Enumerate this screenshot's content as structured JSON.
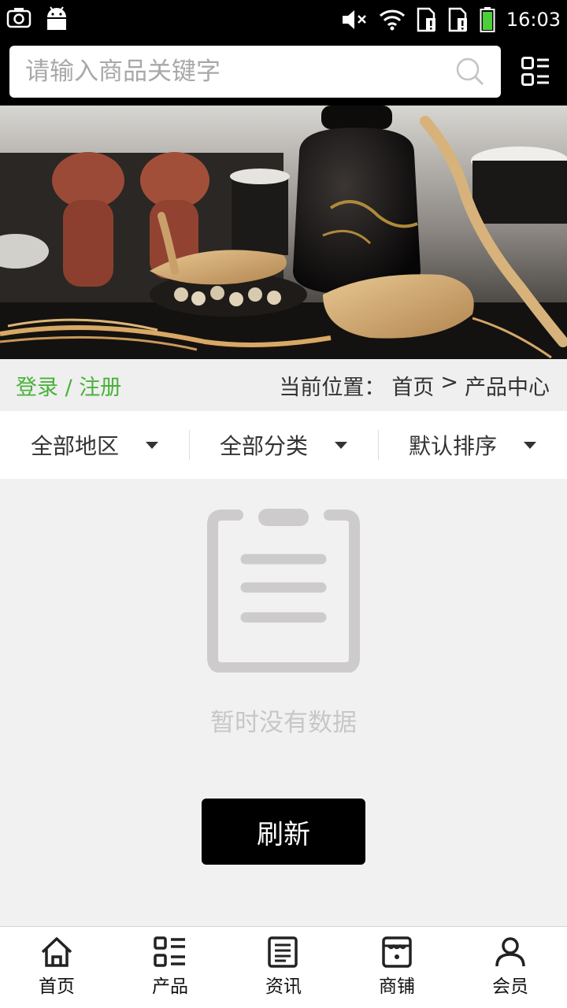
{
  "status_bar": {
    "time": "16:03",
    "left_icons": [
      "screenshot-icon",
      "android-icon"
    ],
    "right_icons": [
      "mute-icon",
      "wifi-icon",
      "sim1-icon",
      "sim2-icon",
      "battery-icon"
    ]
  },
  "search": {
    "placeholder": "请输入商品关键字"
  },
  "banner": {
    "alt": "ginseng"
  },
  "location_bar": {
    "login_label": "登录 / 注册",
    "prefix": "当前位置：",
    "crumb_home": "首页",
    "separator": ">",
    "crumb_current": "产品中心"
  },
  "filters": [
    {
      "label": "全部地区"
    },
    {
      "label": "全部分类"
    },
    {
      "label": "默认排序"
    }
  ],
  "empty_state": {
    "message": "暂时没有数据",
    "refresh_label": "刷新"
  },
  "bottom_nav": [
    {
      "label": "首页",
      "icon": "home-icon"
    },
    {
      "label": "产品",
      "icon": "grid-list-icon"
    },
    {
      "label": "资讯",
      "icon": "news-icon"
    },
    {
      "label": "商铺",
      "icon": "shop-icon"
    },
    {
      "label": "会员",
      "icon": "user-icon"
    }
  ],
  "colors": {
    "accent_green": "#49b13a",
    "header_bg": "#000000",
    "page_bg": "#f1f1f1"
  }
}
